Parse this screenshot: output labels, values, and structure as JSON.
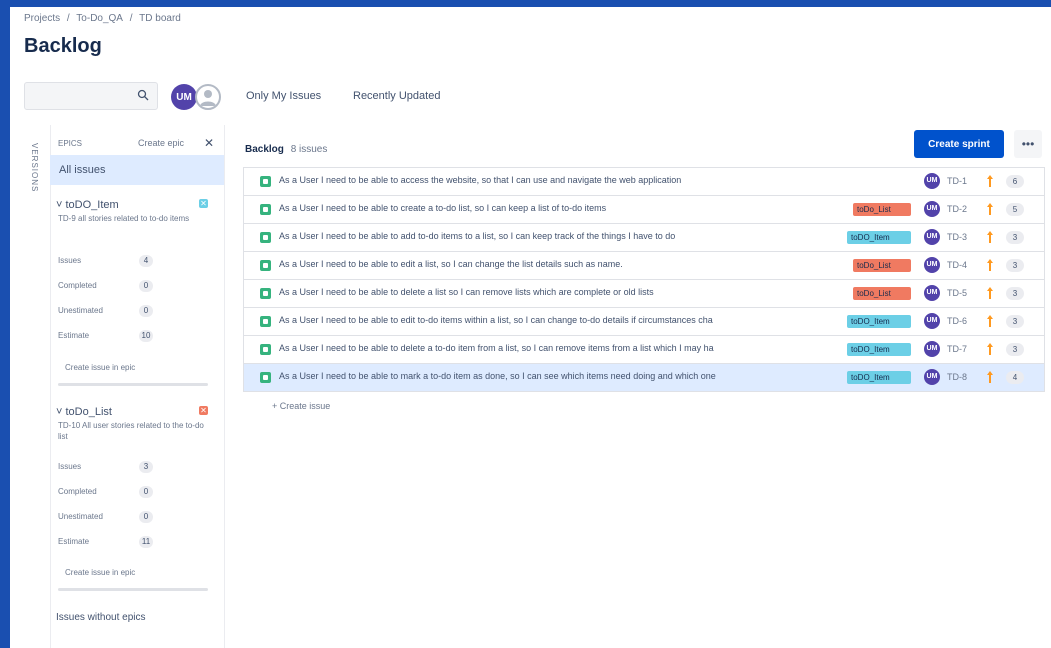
{
  "breadcrumb": [
    "Projects",
    "/",
    "To-Do_QA",
    "/",
    "TD board"
  ],
  "page_title": "Backlog",
  "toolbar": {
    "avatar_initials": "UM",
    "only_my_issues": "Only My Issues",
    "recently_updated": "Recently Updated"
  },
  "sidebar": {
    "versions_label": "VERSIONS",
    "epics_header": "EPICS",
    "create_epic": "Create epic",
    "close": "✕",
    "all_issues": "All issues",
    "issues_without_epics": "Issues without epics",
    "epics": [
      {
        "name": "toDO_Item",
        "color": "#6ccfe6",
        "description": "TD-9 all stories related to to-do items",
        "stats": [
          {
            "label": "Issues",
            "value": "4"
          },
          {
            "label": "Completed",
            "value": "0"
          },
          {
            "label": "Unestimated",
            "value": "0"
          },
          {
            "label": "Estimate",
            "value": "10"
          }
        ],
        "create_link": "Create issue in epic"
      },
      {
        "name": "toDo_List",
        "color": "#f07a61",
        "description": "TD-10 All user stories related to the to-do list",
        "stats": [
          {
            "label": "Issues",
            "value": "3"
          },
          {
            "label": "Completed",
            "value": "0"
          },
          {
            "label": "Unestimated",
            "value": "0"
          },
          {
            "label": "Estimate",
            "value": "11"
          }
        ],
        "create_link": "Create issue in epic"
      }
    ]
  },
  "backlog": {
    "title": "Backlog",
    "count": "8 issues",
    "create_sprint": "Create sprint",
    "more": "•••",
    "create_issue": "+ Create issue",
    "issues": [
      {
        "summary": "As a User I need to be able to access the website, so that I can use and navigate the web application",
        "epic": "",
        "epic_type": "",
        "assignee": "UM",
        "key": "TD-1",
        "estimate": "6",
        "selected": false
      },
      {
        "summary": "As a User I need to be able to create a to-do list, so I can keep a list of to-do items",
        "epic": "toDo_List",
        "epic_type": "list",
        "assignee": "UM",
        "key": "TD-2",
        "estimate": "5",
        "selected": false
      },
      {
        "summary": "As a User I need to be able to add to-do items to a list, so I can keep track of the things I have to do",
        "epic": "toDO_Item",
        "epic_type": "item",
        "assignee": "UM",
        "key": "TD-3",
        "estimate": "3",
        "selected": false
      },
      {
        "summary": "As a User I need to be able to edit a list, so I can change the list details such as name.",
        "epic": "toDo_List",
        "epic_type": "list",
        "assignee": "UM",
        "key": "TD-4",
        "estimate": "3",
        "selected": false
      },
      {
        "summary": "As a User I need to be able to delete a list so I can remove lists which are complete or old lists",
        "epic": "toDo_List",
        "epic_type": "list",
        "assignee": "UM",
        "key": "TD-5",
        "estimate": "3",
        "selected": false
      },
      {
        "summary": "As a User I need to be able to edit to-do items within a list, so I can change to-do details if circumstances cha",
        "epic": "toDO_Item",
        "epic_type": "item",
        "assignee": "UM",
        "key": "TD-6",
        "estimate": "3",
        "selected": false
      },
      {
        "summary": "As a User I need to be able to delete a to-do item from a list, so I can remove items from a list which I may ha",
        "epic": "toDO_Item",
        "epic_type": "item",
        "assignee": "UM",
        "key": "TD-7",
        "estimate": "3",
        "selected": false
      },
      {
        "summary": "As a User I need to be able to mark a to-do item as done, so I can see which items need doing and which one",
        "epic": "toDO_Item",
        "epic_type": "item",
        "assignee": "UM",
        "key": "TD-8",
        "estimate": "4",
        "selected": true
      }
    ]
  },
  "colors": {
    "brand": "#0052cc",
    "story": "#36b37e",
    "avatar": "#5243aa",
    "priority": "#ff991f",
    "selected_row": "#deebff"
  }
}
